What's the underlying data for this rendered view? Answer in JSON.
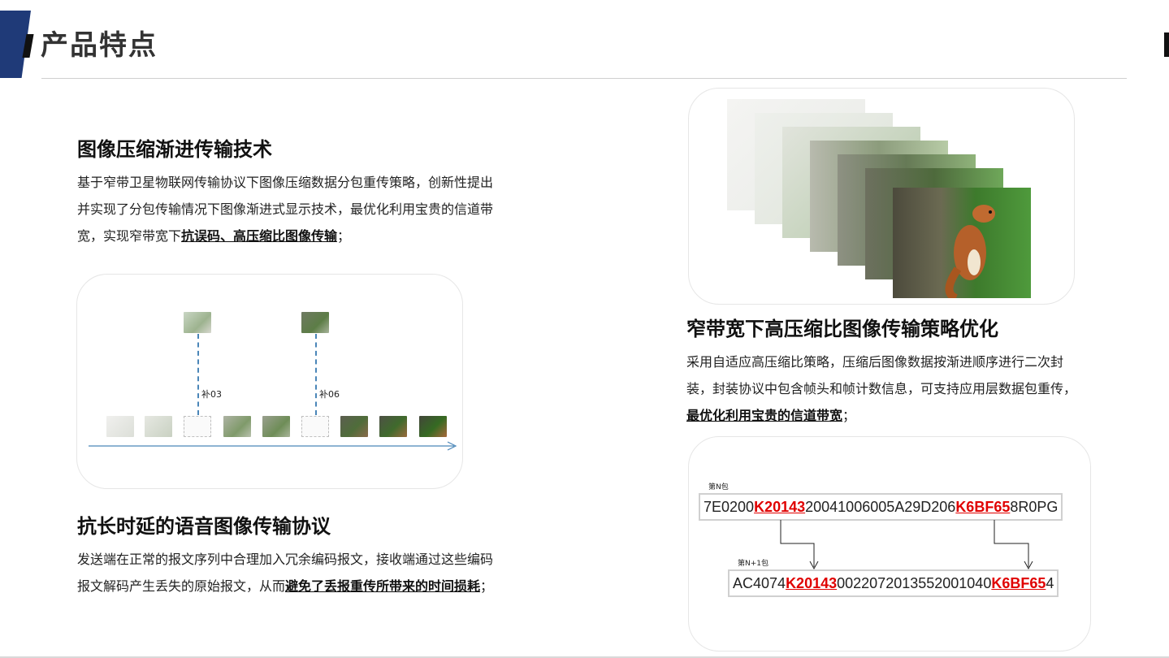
{
  "header": {
    "title": "产品特点"
  },
  "section1": {
    "title": "图像压缩渐进传输技术",
    "body_line1": "基于窄带卫星物联网传输协议下图像压缩数据分包重传策略，创新性提出",
    "body_line2": "并实现了分包传输情况下图像渐进式显示技术，最优化利用宝贵的信道带",
    "body_line3_pre": "宽，实现窄带宽下",
    "body_line3_bold": "抗误码、高压缩比图像传输",
    "body_line3_post": "；"
  },
  "diagram1": {
    "label_a": "补03",
    "label_b": "补06"
  },
  "section2": {
    "title": "抗长时延的语音图像传输协议",
    "body_line1": "发送端在正常的报文序列中合理加入冗余编码报文，接收端通过这些编码",
    "body_line2_pre": "报文解码产生丢失的原始报文，从而",
    "body_line2_bold": "避免了丢报重传所带来的时间损耗",
    "body_line2_post": "；"
  },
  "section3": {
    "title": "窄带宽下高压缩比图像传输策略优化",
    "body_line1": "采用自适应高压缩比策略，压缩后图像数据按渐进顺序进行二次封",
    "body_line2": "装，封装协议中包含帧头和帧计数信息，可支持应用层数据包重传，",
    "body_line3_bold": "最优化利用宝贵的信道带宽",
    "body_line3_post": "；"
  },
  "packets": {
    "p1_label": "第N包",
    "p1_a": "7E0200",
    "p1_h1": "K20143",
    "p1_b": "20041006005A29D206",
    "p1_h2": "K6BF65",
    "p1_c": "8R0PG",
    "p2_label": "第N+1包",
    "p2_a": "AC4074",
    "p2_h1": "K20143",
    "p2_b": "002207201355200104",
    "p2_mid": "0",
    "p2_h2": "K6BF65",
    "p2_c": "4"
  },
  "colors": {
    "accent": "#1f3a78",
    "highlight": "#e00000",
    "arrow": "#4a86b8"
  }
}
